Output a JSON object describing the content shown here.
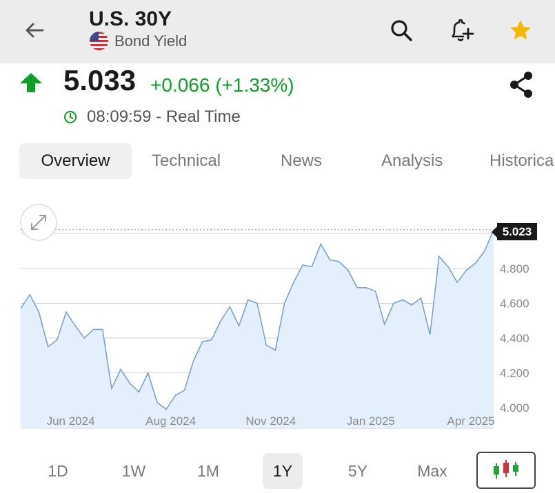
{
  "header": {
    "title": "U.S. 30Y",
    "subtitle": "Bond Yield",
    "icons": {
      "back": "arrow-left-icon",
      "flag": "us-flag-icon",
      "search": "search-icon",
      "alert": "bell-plus-icon",
      "favorite": "star-icon"
    },
    "favorite_color": "#f5b800"
  },
  "quote": {
    "price": "5.033",
    "change": "+0.066 (+1.33%)",
    "direction": "up",
    "time": "08:09:59 - Real Time",
    "color_up": "#0e9f29"
  },
  "tabs": [
    {
      "label": "Overview",
      "active": true
    },
    {
      "label": "Technical",
      "active": false
    },
    {
      "label": "News",
      "active": false
    },
    {
      "label": "Analysis",
      "active": false
    },
    {
      "label": "Historical",
      "active": false
    }
  ],
  "chart_data": {
    "type": "area",
    "current_label": "5.023",
    "ylim": [
      3.98,
      5.06
    ],
    "yticks": [
      4.0,
      4.2,
      4.4,
      4.6,
      4.8
    ],
    "ytick_labels": [
      "4.000",
      "4.200",
      "4.400",
      "4.600",
      "4.800"
    ],
    "xticks": [
      {
        "label": "Jun 2024",
        "index": 5.5
      },
      {
        "label": "Aug 2024",
        "index": 16.5
      },
      {
        "label": "Nov 2024",
        "index": 27.5
      },
      {
        "label": "Jan 2025",
        "index": 38.5
      },
      {
        "label": "Apr 2025",
        "index": 49.5
      }
    ],
    "values": [
      4.57,
      4.65,
      4.55,
      4.35,
      4.39,
      4.55,
      4.47,
      4.4,
      4.45,
      4.45,
      4.11,
      4.22,
      4.14,
      4.09,
      4.2,
      4.03,
      3.99,
      4.07,
      4.1,
      4.27,
      4.38,
      4.39,
      4.5,
      4.58,
      4.47,
      4.62,
      4.6,
      4.36,
      4.33,
      4.6,
      4.72,
      4.82,
      4.81,
      4.94,
      4.85,
      4.84,
      4.79,
      4.69,
      4.69,
      4.67,
      4.48,
      4.6,
      4.62,
      4.59,
      4.63,
      4.42,
      4.87,
      4.81,
      4.72,
      4.79,
      4.83,
      4.9,
      5.023
    ],
    "line_color": "#7aa3c8",
    "fill_color": "#e3f0fc",
    "grid": true
  },
  "ranges": [
    {
      "label": "1D",
      "active": false
    },
    {
      "label": "1W",
      "active": false
    },
    {
      "label": "1M",
      "active": false
    },
    {
      "label": "1Y",
      "active": true
    },
    {
      "label": "5Y",
      "active": false
    },
    {
      "label": "Max",
      "active": false
    }
  ],
  "chart_toggle_icon": "candlestick-icon",
  "expand_icon": "expand-icon"
}
